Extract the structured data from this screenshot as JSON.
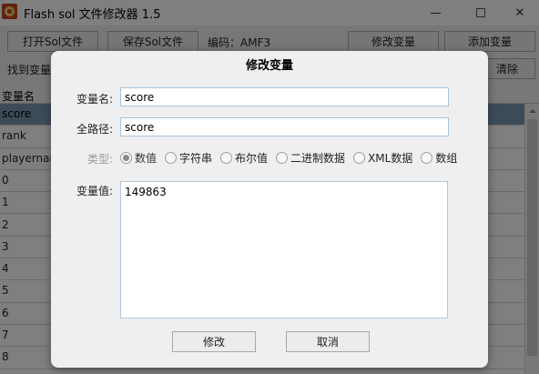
{
  "window": {
    "title": "Flash sol 文件修改器 1.5",
    "controls": {
      "minimize": "—",
      "maximize": "□",
      "close": "✕"
    }
  },
  "toolbar": {
    "open_label": "打开Sol文件",
    "save_label": "保存Sol文件",
    "encoding_text": "编码：AMF3",
    "modify_label": "修改变量",
    "add_label": "添加变量",
    "find_label": "找到变量",
    "clear_label": "清除"
  },
  "grid": {
    "header": "变量名",
    "rows": [
      "score",
      "rank",
      "playernam",
      "0",
      "1",
      "2",
      "3",
      "4",
      "5",
      "6",
      "7",
      "8"
    ],
    "selected_index": 0
  },
  "dialog": {
    "title": "修改变量",
    "name_label": "变量名:",
    "name_value": "score",
    "path_label": "全路径:",
    "path_value": "score",
    "type_label": "类型:",
    "types": [
      "数值",
      "字符串",
      "布尔值",
      "二进制数据",
      "XML数据",
      "数组"
    ],
    "selected_type": "数值",
    "value_label": "变量值:",
    "value": "149863",
    "ok_label": "修改",
    "cancel_label": "取消"
  },
  "colors": {
    "selected_row": "#7b97b3",
    "overlay": "#000000",
    "dialog_bg": "#efefef",
    "input_border": "#a9c2dd"
  }
}
